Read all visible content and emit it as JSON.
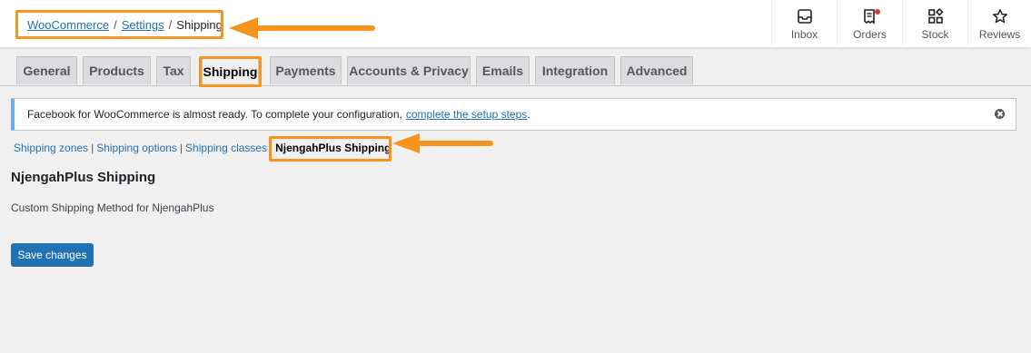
{
  "breadcrumb": {
    "items": [
      "WooCommerce",
      "Settings"
    ],
    "separator": "/",
    "current": "Shipping"
  },
  "activity_bar": [
    {
      "label": "Inbox",
      "icon": "inbox-icon"
    },
    {
      "label": "Orders",
      "icon": "orders-icon",
      "has_notification": true
    },
    {
      "label": "Stock",
      "icon": "stock-icon"
    },
    {
      "label": "Reviews",
      "icon": "star-icon"
    }
  ],
  "tabs": [
    "General",
    "Products",
    "Tax",
    "Shipping",
    "Payments",
    "Accounts & Privacy",
    "Emails",
    "Integration",
    "Advanced"
  ],
  "active_tab": "Shipping",
  "notice": {
    "text": "Facebook for WooCommerce is almost ready. To complete your configuration,",
    "link_text": "complete the setup steps",
    "suffix": "."
  },
  "sections": {
    "links": [
      "Shipping zones",
      "Shipping options",
      "Shipping classes"
    ],
    "separator": "|",
    "current": "NjengahPlus Shipping"
  },
  "page": {
    "title": "NjengahPlus Shipping",
    "description": "Custom Shipping Method for NjengahPlus",
    "save_label": "Save changes"
  },
  "colors": {
    "accent": "#2271b1",
    "annotation": "#f7941d",
    "notice_border": "#72aee6"
  }
}
